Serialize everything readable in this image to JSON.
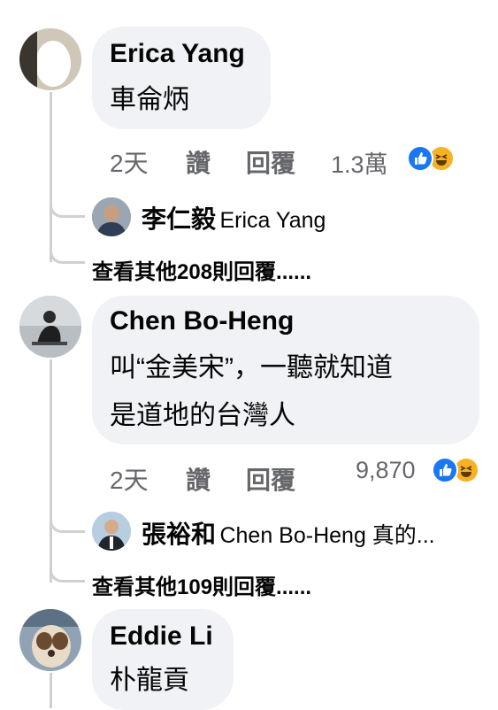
{
  "comments": [
    {
      "author": "Erica Yang",
      "text_lines": [
        "車侖炳"
      ],
      "time": "2天",
      "like_label": "讚",
      "reply_label": "回覆",
      "reaction_count": "1.3萬",
      "reactions": [
        "like-icon",
        "haha-icon"
      ],
      "reply_preview": {
        "author": "李仁毅",
        "text": "Erica Yang"
      },
      "more_replies": "查看其他208則回覆......"
    },
    {
      "author": "Chen Bo-Heng",
      "text_lines": [
        "叫“金美宋”，一聽就知道",
        "是道地的台灣人"
      ],
      "time": "2天",
      "like_label": "讚",
      "reply_label": "回覆",
      "reaction_count": "9,870",
      "reactions": [
        "like-icon",
        "haha-icon"
      ],
      "reply_preview": {
        "author": "張裕和",
        "text": "Chen Bo-Heng 真的..."
      },
      "more_replies": "查看其他109則回覆......"
    },
    {
      "author": "Eddie Li",
      "text_lines": [
        "朴龍貢"
      ]
    }
  ],
  "colors": {
    "bubble": "#f0f2f5",
    "meta_text": "#65676b",
    "thread_line": "#ced0d4",
    "like": "#1877f2",
    "haha": "#f7b125"
  }
}
